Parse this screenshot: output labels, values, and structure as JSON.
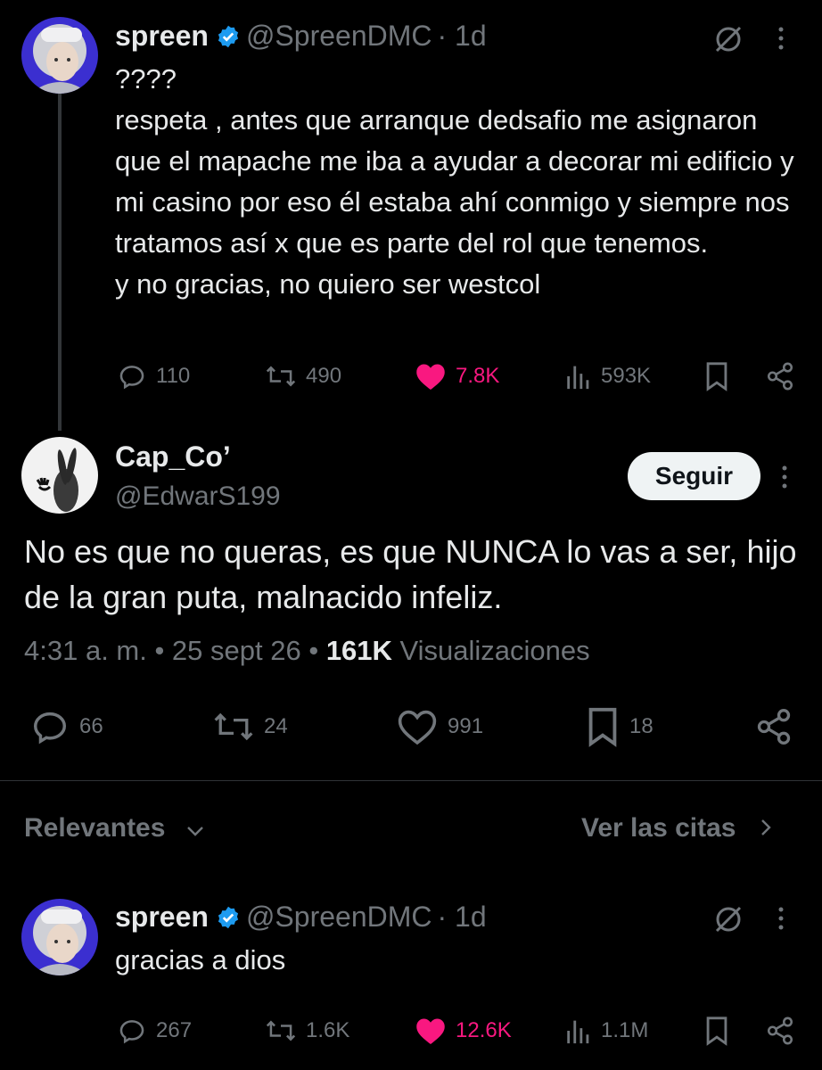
{
  "tweet1": {
    "name": "spreen",
    "handle": "@SpreenDMC",
    "time": "· 1d",
    "text": "????\nrespeta , antes que arranque dedsafio me asignaron que el mapache me iba a ayudar a decorar mi edificio y mi casino por eso él estaba ahí conmigo y siempre nos tratamos así x que es parte del rol que tenemos.\ny no gracias,  no quiero ser westcol",
    "replies": "110",
    "reposts": "490",
    "likes": "7.8K",
    "views": "593K"
  },
  "main": {
    "name": "Cap_Co’",
    "handle": "@EdwarS199",
    "follow_label": "Seguir",
    "text": "No es que no queras, es que NUNCA lo vas a ser, hijo de la gran puta, malnacido infeliz.",
    "time": "4:31 a. m. • 25 sept 26 •",
    "views_count": "161K",
    "views_label": "Visualizaciones",
    "replies": "66",
    "reposts": "24",
    "likes": "991",
    "bookmarks": "18"
  },
  "sort": {
    "label": "Relevantes",
    "quotes_link": "Ver las citas"
  },
  "reply": {
    "name": "spreen",
    "handle": "@SpreenDMC",
    "time": "· 1d",
    "text": "gracias a dios",
    "replies": "267",
    "reposts": "1.6K",
    "likes": "12.6K",
    "views": "1.1M"
  },
  "colors": {
    "like": "#f91880",
    "verified": "#1d9bf0",
    "muted": "#71767b"
  }
}
